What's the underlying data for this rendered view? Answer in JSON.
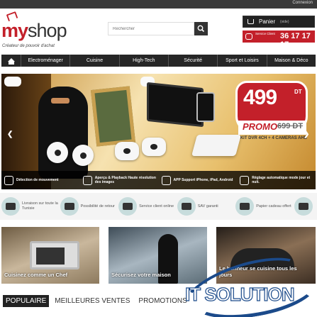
{
  "topbar": {
    "login_label": "Connexion"
  },
  "header": {
    "logo_text_my": "my",
    "logo_text_shop": "shop",
    "tagline": "Créateur de pouvoir d'achat",
    "search_placeholder": "Rechercher",
    "cart_label": "Panier",
    "cart_status": "(vide)",
    "phone_headline": "Service Client",
    "phone_number": "36 17 17 17"
  },
  "nav": {
    "items": [
      {
        "label": "Electroménager"
      },
      {
        "label": "Cuisine"
      },
      {
        "label": "High-Tech"
      },
      {
        "label": "Sécurité"
      },
      {
        "label": "Sport et Loisirs"
      },
      {
        "label": "Maison & Déco"
      }
    ]
  },
  "banner": {
    "price": "499",
    "currency": "DT",
    "promo_label": "PROMO",
    "old_price": "699 DT",
    "kit_text": "KIT DVR 4CH + 4 CAMERAS AHD",
    "features": [
      {
        "text": "Détection de mouvement",
        "icon": "motion-icon"
      },
      {
        "text": "Aperçu & Playback Haute résolution des images",
        "icon": "playback-icon"
      },
      {
        "text": "APP Support iPhone, iPad, Android",
        "icon": "app-icon"
      },
      {
        "text": "Réglage automatique mode jour et nuit.",
        "icon": "day-night-icon"
      }
    ]
  },
  "services": [
    {
      "text": "Livraison sur toute la Tunisie",
      "icon": "truck-icon"
    },
    {
      "text": "Possibilité de retour",
      "icon": "clipboard-icon"
    },
    {
      "text": "Service client online",
      "icon": "support-icon"
    },
    {
      "text": "SAV garanti",
      "icon": "warranty-icon"
    },
    {
      "text": "Papier cadeau offert",
      "icon": "gift-card-icon"
    },
    {
      "text": "",
      "icon": "gift-icon"
    }
  ],
  "tiles": [
    {
      "caption": "Cuisinez comme un Chef"
    },
    {
      "caption": "Sécurisez votre maison"
    },
    {
      "caption": "Le bonheur se cuisine tous les jours"
    }
  ],
  "tabs": [
    {
      "label": "POPULAIRE",
      "active": true
    },
    {
      "label": "MEILLEURES VENTES",
      "active": false
    },
    {
      "label": "PROMOTIONS",
      "active": false
    }
  ],
  "watermark": {
    "text": "IT SOLUTION"
  },
  "colors": {
    "brand_red": "#c3202a",
    "dark": "#262626",
    "service_circle": "#c7dcdc"
  }
}
